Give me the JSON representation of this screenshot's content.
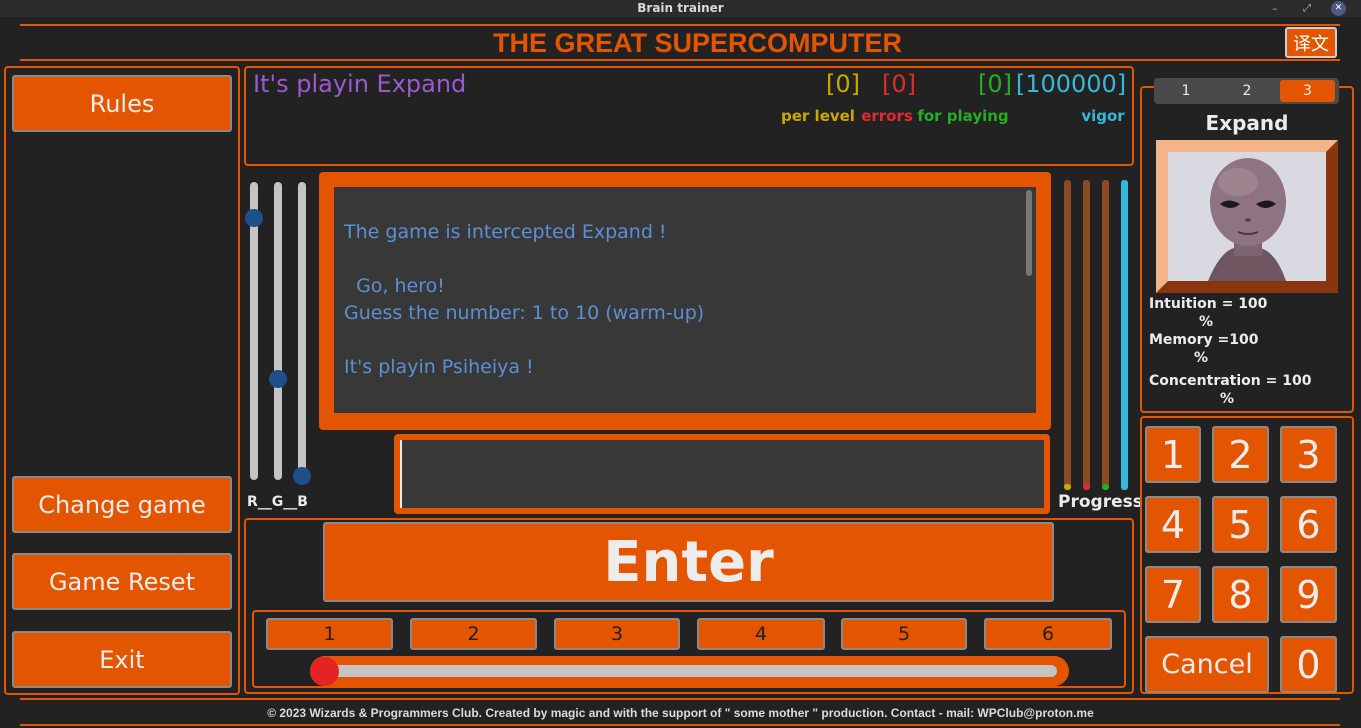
{
  "window": {
    "title": "Brain trainer",
    "controls": {
      "minimize": "–",
      "maximize": "⤢",
      "close": "✕"
    }
  },
  "header": {
    "title": "THE GREAT SUPERCOMPUTER",
    "translate_label": "译文"
  },
  "left_menu": {
    "rules": "Rules",
    "change_game": "Change game",
    "game_reset": "Game Reset",
    "exit": "Exit"
  },
  "status": {
    "playing_text": "It's playin Expand",
    "per_level": {
      "value": "[0]",
      "label": "per level"
    },
    "errors": {
      "value": "[0]",
      "label": "errors"
    },
    "for_playing": {
      "value": "[0]",
      "label": "for playing"
    },
    "vigor": {
      "value": "[100000]",
      "label": "vigor"
    }
  },
  "colors": {
    "accent": "#e35500",
    "per_level": "#c9a800",
    "errors": "#e02b2b",
    "for_playing": "#22b022",
    "vigor": "#36b8d8",
    "message_text": "#5b8fd6",
    "playing_text": "#9b59d0"
  },
  "rgb_sliders": {
    "label": "R__G__B",
    "r_level": 0.88,
    "g_level": 0.34,
    "b_level": 0.0
  },
  "messages": {
    "line1": "The game is intercepted Expand !",
    "line2": "  Go, hero!",
    "line3": "Guess the number: 1 to 10 (warm-up)",
    "line4": "It's playin Psiheiya !"
  },
  "answer_input": {
    "value": ""
  },
  "progress": {
    "label": "Progress",
    "bars": [
      {
        "color": "#c9a800",
        "level": 0.0
      },
      {
        "color": "#e02b2b",
        "level": 0.0
      },
      {
        "color": "#22b022",
        "level": 0.0
      },
      {
        "color": "#36b8d8",
        "level": 1.0
      }
    ]
  },
  "enter_label": "Enter",
  "levels": {
    "items": [
      "1",
      "2",
      "3",
      "4",
      "5",
      "6"
    ],
    "slider_value": 0.0
  },
  "character": {
    "tabs": [
      "1",
      "2",
      "3"
    ],
    "active_tab": "3",
    "name": "Expand",
    "stats": {
      "intuition": "Intuition = 100",
      "intuition_unit": "%",
      "memory": "Memory =100",
      "memory_unit": "%",
      "concentration": "Concentration = 100",
      "concentration_unit": "%"
    }
  },
  "keypad": {
    "digits": [
      "1",
      "2",
      "3",
      "4",
      "5",
      "6",
      "7",
      "8",
      "9"
    ],
    "cancel": "Cancel",
    "zero": "0"
  },
  "footer": {
    "text": "© 2023 Wizards & Programmers Club. Created by magic and with the support of \" some mother \" production. Contact - mail: WPClub@proton.me"
  }
}
